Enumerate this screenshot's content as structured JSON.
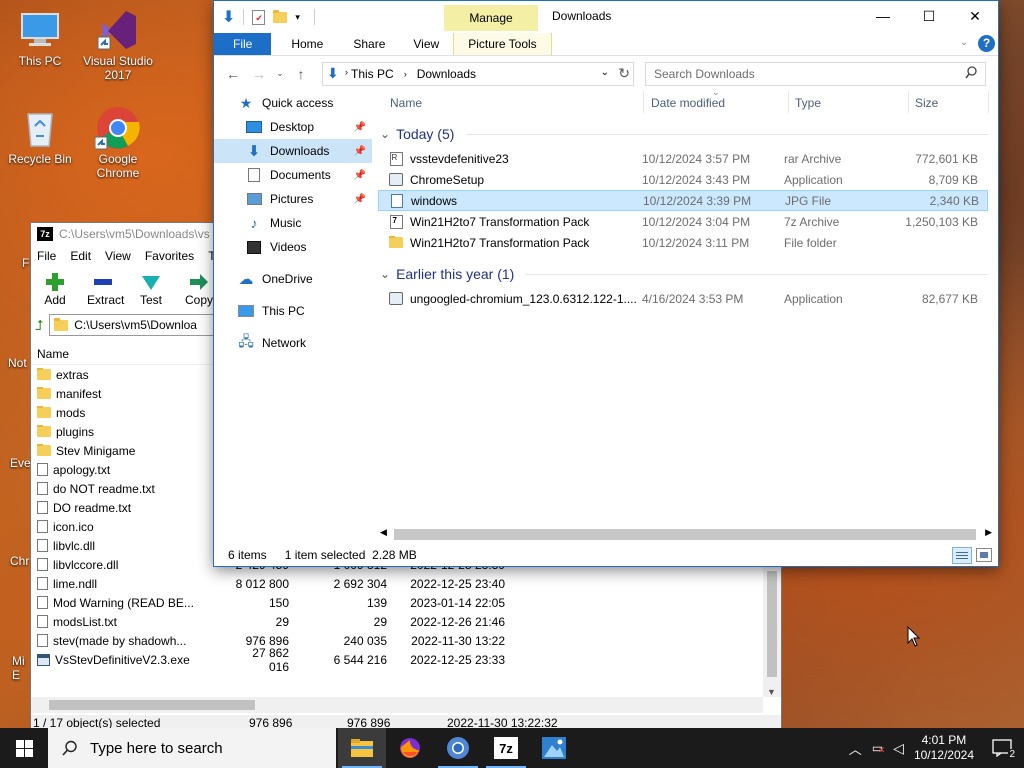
{
  "desktop": {
    "icons": [
      {
        "label": "This PC"
      },
      {
        "label": "Visual Studio 2017"
      },
      {
        "label": "Recycle Bin"
      },
      {
        "label": "Google Chrome"
      }
    ],
    "partial_labels": [
      "F",
      "Not",
      "Eve",
      "Chr",
      "Mi",
      "E"
    ]
  },
  "zip": {
    "title": "C:\\Users\\vm5\\Downloads\\vs",
    "menu": [
      "File",
      "Edit",
      "View",
      "Favorites",
      "To"
    ],
    "tools": [
      "Add",
      "Extract",
      "Test",
      "Copy",
      "M"
    ],
    "path": "C:\\Users\\vm5\\Downloa",
    "col_name": "Name",
    "rows": [
      {
        "type": "folder",
        "name": "extras",
        "size": "",
        "packed": "",
        "modified": ""
      },
      {
        "type": "folder",
        "name": "manifest",
        "size": "",
        "packed": "",
        "modified": ""
      },
      {
        "type": "folder",
        "name": "mods",
        "size": "",
        "packed": "",
        "modified": ""
      },
      {
        "type": "folder",
        "name": "plugins",
        "size": "",
        "packed": "",
        "modified": ""
      },
      {
        "type": "folder",
        "name": "Stev Minigame",
        "size": "",
        "packed": "",
        "modified": ""
      },
      {
        "type": "doc",
        "name": "apology.txt",
        "size": "",
        "packed": "",
        "modified": ""
      },
      {
        "type": "doc",
        "name": "do NOT readme.txt",
        "size": "",
        "packed": "",
        "modified": ""
      },
      {
        "type": "doc",
        "name": "DO readme.txt",
        "size": "",
        "packed": "",
        "modified": ""
      },
      {
        "type": "doc",
        "name": "icon.ico",
        "size": "",
        "packed": "",
        "modified": ""
      },
      {
        "type": "doc",
        "name": "libvlc.dll",
        "size": "",
        "packed": "",
        "modified": ""
      },
      {
        "type": "doc",
        "name": "libvlccore.dll",
        "size": "2 429 459",
        "packed": "1 009 812",
        "modified": "2022-12-25 23:39"
      },
      {
        "type": "doc",
        "name": "lime.ndll",
        "size": "8 012 800",
        "packed": "2 692 304",
        "modified": "2022-12-25 23:40"
      },
      {
        "type": "doc",
        "name": "Mod Warning (READ BE...",
        "size": "150",
        "packed": "139",
        "modified": "2023-01-14 22:05"
      },
      {
        "type": "doc",
        "name": "modsList.txt",
        "size": "29",
        "packed": "29",
        "modified": "2022-12-26 21:46"
      },
      {
        "type": "doc",
        "name": "stev(made by shadowh...",
        "size": "976 896",
        "packed": "240 035",
        "modified": "2022-11-30 13:22"
      },
      {
        "type": "exe",
        "name": "VsStevDefinitiveV2.3.exe",
        "size": "27 862 016",
        "packed": "6 544 216",
        "modified": "2022-12-25 23:33"
      }
    ],
    "status": {
      "selected": "1 / 17 object(s) selected",
      "size": "976 896",
      "packed": "976 896",
      "modified": "2022-11-30 13:22:32"
    }
  },
  "explorer": {
    "title": "Downloads",
    "manage": "Manage",
    "tabs": [
      "File",
      "Home",
      "Share",
      "View",
      "Picture Tools"
    ],
    "breadcrumb": [
      "This PC",
      "Downloads"
    ],
    "search_placeholder": "Search Downloads",
    "nav": [
      {
        "label": "Quick access",
        "icon": "star-icon",
        "pinned": false,
        "selected": false,
        "indent": 0
      },
      {
        "label": "Desktop",
        "icon": "desktop-icon",
        "pinned": true,
        "selected": false,
        "indent": 1
      },
      {
        "label": "Downloads",
        "icon": "download-arrow-icon",
        "pinned": true,
        "selected": true,
        "indent": 1
      },
      {
        "label": "Documents",
        "icon": "document-icon",
        "pinned": true,
        "selected": false,
        "indent": 1
      },
      {
        "label": "Pictures",
        "icon": "picture-icon",
        "pinned": true,
        "selected": false,
        "indent": 1
      },
      {
        "label": "Music",
        "icon": "music-icon",
        "pinned": false,
        "selected": false,
        "indent": 1
      },
      {
        "label": "Videos",
        "icon": "video-icon",
        "pinned": false,
        "selected": false,
        "indent": 1
      },
      {
        "label": "OneDrive",
        "icon": "cloud-icon",
        "pinned": false,
        "selected": false,
        "indent": 0
      },
      {
        "label": "This PC",
        "icon": "pc-icon",
        "pinned": false,
        "selected": false,
        "indent": 0
      },
      {
        "label": "Network",
        "icon": "network-icon",
        "pinned": false,
        "selected": false,
        "indent": 0
      }
    ],
    "columns": [
      "Name",
      "Date modified",
      "Type",
      "Size"
    ],
    "groups": [
      {
        "label": "Today (5)",
        "files": [
          {
            "name": "vsstevdefenitive23",
            "date": "10/12/2024 3:57 PM",
            "type": "rar Archive",
            "size": "772,601 KB",
            "icon": "rar-icon",
            "selected": false
          },
          {
            "name": "ChromeSetup",
            "date": "10/12/2024 3:43 PM",
            "type": "Application",
            "size": "8,709 KB",
            "icon": "app-icon",
            "selected": false
          },
          {
            "name": "windows",
            "date": "10/12/2024 3:39 PM",
            "type": "JPG File",
            "size": "2,340 KB",
            "icon": "jpg-icon",
            "selected": true
          },
          {
            "name": "Win21H2to7 Transformation Pack",
            "date": "10/12/2024 3:04 PM",
            "type": "7z Archive",
            "size": "1,250,103 KB",
            "icon": "7z-icon",
            "selected": false
          },
          {
            "name": "Win21H2to7 Transformation Pack",
            "date": "10/12/2024 3:11 PM",
            "type": "File folder",
            "size": "",
            "icon": "folder-icon",
            "selected": false
          }
        ]
      },
      {
        "label": "Earlier this year (1)",
        "files": [
          {
            "name": "ungoogled-chromium_123.0.6312.122-1....",
            "date": "4/16/2024 3:53 PM",
            "type": "Application",
            "size": "82,677 KB",
            "icon": "app-icon",
            "selected": false
          }
        ]
      }
    ],
    "status": {
      "items": "6 items",
      "selected": "1 item selected",
      "size": "2.28 MB"
    }
  },
  "taskbar": {
    "search_placeholder": "Type here to search",
    "time": "4:01 PM",
    "date": "10/12/2024",
    "notifications": "2"
  }
}
